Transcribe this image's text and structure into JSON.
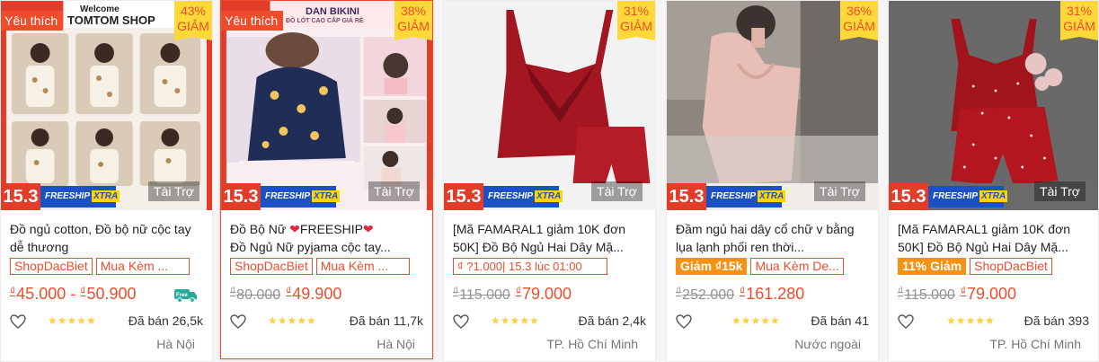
{
  "products": [
    {
      "favorite_tag": "Yêu thích",
      "shop_banner": "TOMTOM SHOP",
      "banner_sub": "Welcome",
      "discount_pct": "43%",
      "discount_word": "GIẢM",
      "promo_date": "15.3",
      "promo_ship": "FREESHIP",
      "promo_xtra": "XTRA",
      "sponsored": "Tài Trợ",
      "title": "Đồ ngủ cotton, Đồ bộ nữ cộc tay dễ thương",
      "labels": [
        "ShopDacBiet",
        "Mua Kèm ..."
      ],
      "price_min": "45.000",
      "price_sep": "-",
      "price_max": "50.900",
      "currency": "₫",
      "free_icon": "Free",
      "stars": "★★★★★",
      "sold": "Đã bán 26,5k",
      "location": "Hà Nội"
    },
    {
      "favorite_tag": "Yêu thích",
      "shop_banner": "ĐỒ LÓT CAO CẤP GIÁ RẺ",
      "banner_sub": "DAN BIKINI",
      "discount_pct": "38%",
      "discount_word": "GIẢM",
      "promo_date": "15.3",
      "promo_ship": "FREESHIP",
      "promo_xtra": "XTRA",
      "sponsored": "Tài Trợ",
      "title_part1": "Đồ Bộ Nữ ",
      "title_part2": "FREESHIP",
      "title_part3": "Đồ Ngủ Nữ pyjama cộc tay...",
      "heart_emoji": "❤",
      "labels": [
        "ShopDacBiet",
        "Mua Kèm ..."
      ],
      "price_old": "80.000",
      "price_new": "49.900",
      "currency": "₫",
      "stars": "★★★★★",
      "sold": "Đã bán 11,7k",
      "location": "Hà Nội"
    },
    {
      "discount_pct": "31%",
      "discount_word": "GIẢM",
      "promo_date": "15.3",
      "promo_ship": "FREESHIP",
      "promo_xtra": "XTRA",
      "sponsored": "Tài Trợ",
      "title": "[Mã FAMARAL1 giảm 10K đơn 50K] Đồ Bộ Ngủ Hai Dây Mặ...",
      "labels": [
        "₫ ?1.000| 15.3 lúc 01:00"
      ],
      "price_old": "115.000",
      "price_new": "79.000",
      "currency": "₫",
      "stars": "★★★★★",
      "sold": "Đã bán 2,4k",
      "location": "TP. Hồ Chí Minh"
    },
    {
      "discount_pct": "36%",
      "discount_word": "GIẢM",
      "promo_date": "15.3",
      "promo_ship": "FREESHIP",
      "promo_xtra": "XTRA",
      "sponsored": "Tài Trợ",
      "title": "Đầm ngủ hai dây cổ chữ v bằng lụa lạnh phối ren thời...",
      "labels": [
        "Giảm ₫15k",
        "Mua Kèm De..."
      ],
      "price_old": "252.000",
      "price_new": "161.280",
      "currency": "₫",
      "stars": "★★★★★",
      "sold": "Đã bán 41",
      "location": "Nước ngoài"
    },
    {
      "discount_pct": "31%",
      "discount_word": "GIẢM",
      "promo_date": "15.3",
      "promo_ship": "FREESHIP",
      "promo_xtra": "XTRA",
      "sponsored": "Tài Trợ",
      "title": "[Mã FAMARAL1 giảm 10K đơn 50K] Đồ Bộ Ngủ Hai Dây Mặ...",
      "labels": [
        "11% Giảm",
        "ShopDacBiet"
      ],
      "price_old": "115.000",
      "price_new": "79.000",
      "currency": "₫",
      "stars": "★★★★★",
      "sold": "Đã bán 393",
      "location": "TP. Hồ Chí Minh"
    }
  ],
  "colors": {
    "brand": "#ee4d2d",
    "discount_bg": "#ffd839",
    "promo_red": "#e33d2a",
    "promo_blue": "#1c51c6",
    "star": "#ffce3d",
    "muted": "#757575"
  },
  "icons": {
    "favorite": "heart-outline-icon",
    "free_shipping": "truck-icon",
    "rating": "star-icon"
  }
}
